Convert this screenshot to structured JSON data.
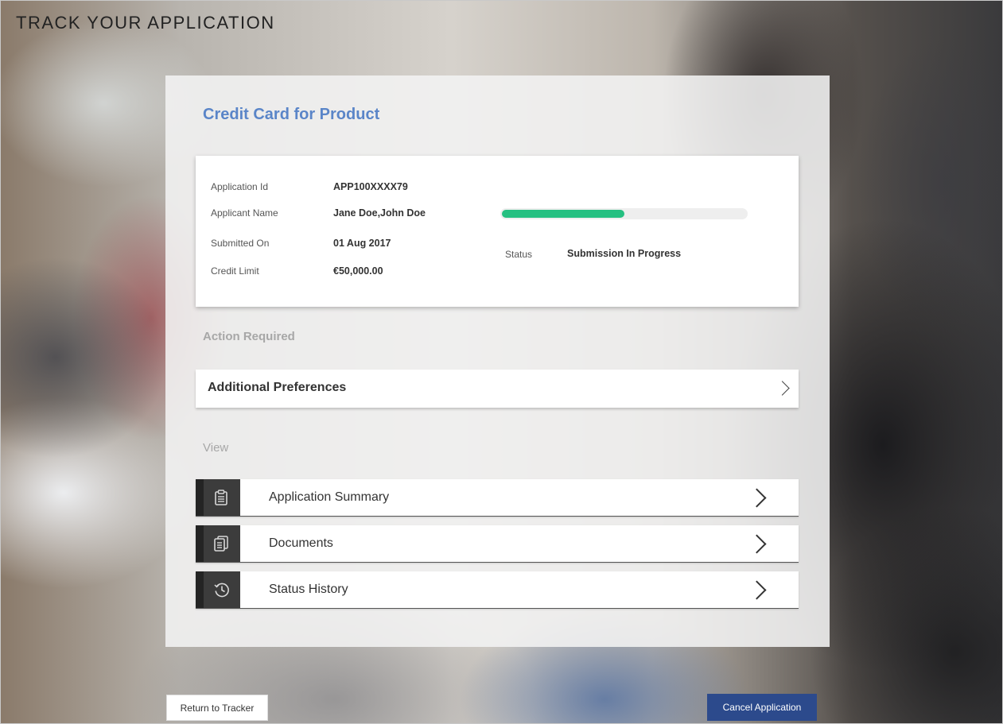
{
  "page": {
    "title": "TRACK YOUR APPLICATION"
  },
  "product": {
    "title": "Credit Card for Product"
  },
  "summary": {
    "fields": [
      {
        "label": "Application Id",
        "value": "APP100XXXX79"
      },
      {
        "label": "Applicant Name",
        "value": "Jane Doe,John Doe"
      },
      {
        "label": "Submitted On",
        "value": "01 Aug 2017"
      },
      {
        "label": "Credit Limit",
        "value": "€50,000.00"
      }
    ],
    "progress_fraction": 0.5,
    "progress_color": "#25c081",
    "status_label": "Status",
    "status_value": "Submission In Progress"
  },
  "action_required": {
    "heading": "Action Required",
    "items": [
      {
        "label": "Additional Preferences",
        "icon": "chevron-right-icon"
      }
    ]
  },
  "view": {
    "heading": "View",
    "items": [
      {
        "label": "Application Summary",
        "icon": "clipboard-icon"
      },
      {
        "label": "Documents",
        "icon": "documents-icon"
      },
      {
        "label": "Status History",
        "icon": "history-clock-icon"
      }
    ]
  },
  "buttons": {
    "return_label": "Return to Tracker",
    "cancel_label": "Cancel Application",
    "cancel_color": "#2c4a8c"
  }
}
